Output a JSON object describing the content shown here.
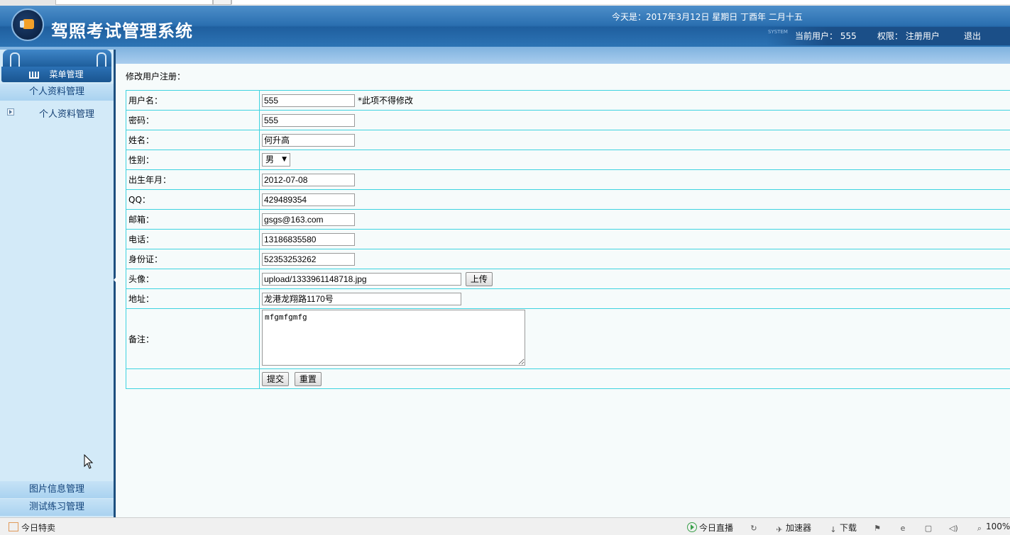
{
  "header": {
    "title": "驾照考试管理系统",
    "date": "今天是：2017年3月12日 星期日 丁酉年 二月十五",
    "system_mark": "SYSTEM",
    "current_user": "当前用户： 555",
    "permission": "权限： 注册用户",
    "logout": "退出"
  },
  "sidebar": {
    "menu_title": "菜单管理",
    "section_personal": "个人资料管理",
    "sub_item": "个人资料管理",
    "section_images": "图片信息管理",
    "section_tests": "测试练习管理"
  },
  "form": {
    "title": "修改用户注册：",
    "labels": {
      "username": "用户名：",
      "password": "密码：",
      "name": "姓名：",
      "gender": "性别：",
      "birth": "出生年月：",
      "qq": "QQ：",
      "email": "邮箱：",
      "phone": "电话：",
      "id": "身份证：",
      "avatar": "头像：",
      "address": "地址：",
      "remark": "备注："
    },
    "values": {
      "username": "555",
      "password": "555",
      "name": "何升高",
      "gender": "男",
      "birth": "2012-07-08",
      "qq": "429489354",
      "email": "gsgs@163.com",
      "phone": "13186835580",
      "id": "52353253262",
      "avatar": "upload/1333961148718.jpg",
      "address": "龙港龙翔路1170号",
      "remark": "mfgmfgmfg"
    },
    "username_note": "*此项不得修改",
    "upload_button": "上传",
    "submit_button": "提交",
    "reset_button": "重置"
  },
  "statusbar": {
    "deals": "今日特卖",
    "live": "今日直播",
    "accelerator": "加速器",
    "download": "下载",
    "zoom": "100%"
  }
}
